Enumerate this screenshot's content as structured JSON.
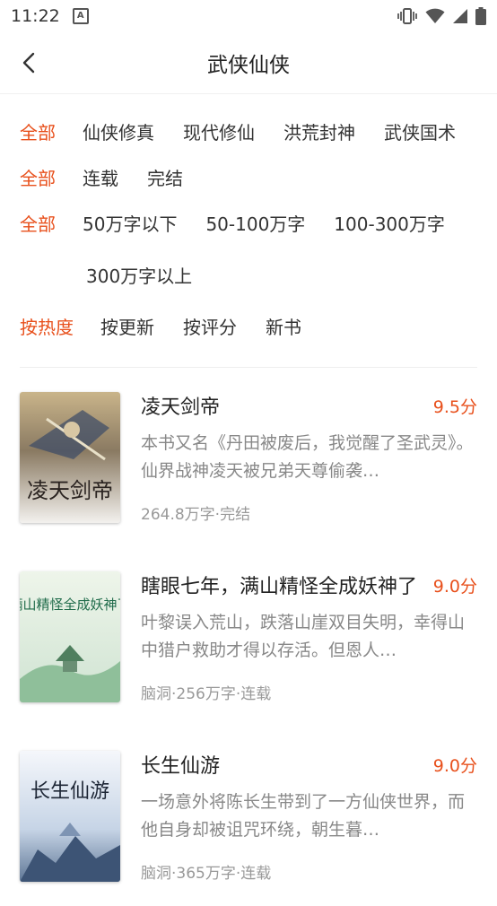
{
  "status": {
    "time": "11:22"
  },
  "header": {
    "title": "武侠仙侠"
  },
  "filters": {
    "category": [
      "全部",
      "仙侠修真",
      "现代修仙",
      "洪荒封神",
      "武侠国术"
    ],
    "status": [
      "全部",
      "连载",
      "完结"
    ],
    "length": [
      "全部",
      "50万字以下",
      "50-100万字",
      "100-300万字",
      "300万字以上"
    ],
    "sort": [
      "按热度",
      "按更新",
      "按评分",
      "新书"
    ]
  },
  "books": [
    {
      "title": "凌天剑帝",
      "score": "9.5分",
      "desc": "本书又名《丹田被废后，我觉醒了圣武灵》。仙界战神凌天被兄弟天尊偷袭…",
      "meta": "264.8万字·完结",
      "cover_text": "凌天剑帝"
    },
    {
      "title": "瞎眼七年，满山精怪全成妖神了",
      "score": "9.0分",
      "desc": "叶黎误入荒山，跌落山崖双目失明，幸得山中猎户救助才得以存活。但恩人…",
      "meta": "脑洞·256万字·连载",
      "cover_text": "满山精怪全成妖神了"
    },
    {
      "title": "长生仙游",
      "score": "9.0分",
      "desc": "一场意外将陈长生带到了一方仙侠世界，而他自身却被诅咒环绕，朝生暮…",
      "meta": "脑洞·365万字·连载",
      "cover_text": "长生仙游"
    }
  ]
}
